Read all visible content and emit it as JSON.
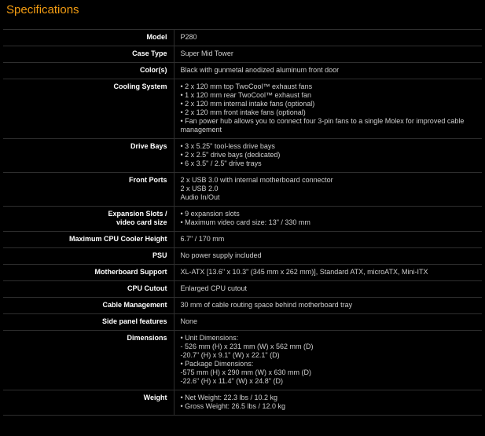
{
  "page": {
    "title": "Specifications",
    "accent_color": "#f39c12",
    "background_color": "#000000"
  },
  "specs": [
    {
      "label": "Model",
      "lines": [
        "P280"
      ]
    },
    {
      "label": "Case Type",
      "lines": [
        "Super Mid Tower"
      ]
    },
    {
      "label": "Color(s)",
      "lines": [
        "Black with gunmetal anodized aluminum front door"
      ]
    },
    {
      "label": "Cooling System",
      "lines": [
        "• 2 x 120 mm top TwoCool™ exhaust fans",
        "• 1 x 120 mm rear TwoCool™ exhaust fan",
        "• 2 x 120 mm internal intake fans (optional)",
        "• 2 x 120 mm front intake fans (optional)",
        "• Fan power hub allows you to connect four 3-pin fans to a single Molex for improved cable management"
      ]
    },
    {
      "label": "Drive Bays",
      "lines": [
        "• 3 x 5.25\" tool-less drive bays",
        "• 2 x 2.5\" drive bays (dedicated)",
        "• 6 x 3.5\" / 2.5\" drive trays"
      ]
    },
    {
      "label": "Front Ports",
      "lines": [
        "2 x USB 3.0 with internal motherboard connector",
        "2 x USB 2.0",
        "Audio In/Out"
      ]
    },
    {
      "label": "Expansion Slots /\nvideo card size",
      "lines": [
        "• 9 expansion slots",
        "• Maximum video card size: 13\" / 330 mm"
      ]
    },
    {
      "label": "Maximum CPU Cooler Height",
      "lines": [
        "6.7\" / 170 mm"
      ]
    },
    {
      "label": "PSU",
      "lines": [
        "No power supply included"
      ]
    },
    {
      "label": "Motherboard Support",
      "lines": [
        "XL-ATX [13.6\" x 10.3\" (345 mm x 262 mm)], Standard ATX, microATX, Mini-ITX"
      ]
    },
    {
      "label": "CPU Cutout",
      "lines": [
        "Enlarged CPU cutout"
      ]
    },
    {
      "label": "Cable Management",
      "lines": [
        "30 mm of cable routing space behind motherboard tray"
      ]
    },
    {
      "label": "Side panel features",
      "lines": [
        "None"
      ]
    },
    {
      "label": "Dimensions",
      "lines": [
        "• Unit Dimensions:",
        "- 526 mm (H) x 231 mm (W) x 562 mm (D)",
        "-20.7\" (H) x 9.1\" (W) x 22.1\" (D)",
        "• Package Dimensions:",
        "-575 mm (H) x 290 mm (W) x 630 mm (D)",
        "-22.6\" (H) x 11.4\" (W) x 24.8\" (D)"
      ]
    },
    {
      "label": "Weight",
      "lines": [
        "• Net Weight: 22.3 lbs / 10.2 kg",
        "• Gross Weight: 26.5 lbs / 12.0 kg"
      ]
    }
  ]
}
